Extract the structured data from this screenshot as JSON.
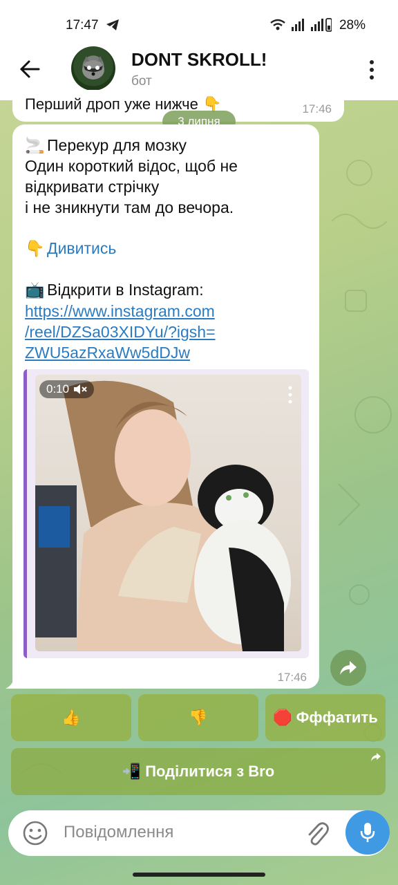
{
  "status": {
    "time": "17:47",
    "battery": "28%"
  },
  "header": {
    "title": "DONT SKROLL!",
    "subtitle": "бот"
  },
  "previous_message": {
    "text": "Перший дроп уже нижче 👇",
    "time": "17:46"
  },
  "date_separator": "3 липня",
  "message": {
    "line1": "Перекур для мозку",
    "line2": "Один короткий відос, щоб не",
    "line3": "відкривати стрічку",
    "line4": "і не зникнути там до вечора.",
    "watch_link": "Дивитись",
    "instagram_label": "Відкрити в Instagram:",
    "url_line1": "https://www.instagram.com",
    "url_line2": "/reel/DZSa03XIDYu/?igsh=",
    "url_line3": "ZWU5azRxaWw5dDJw",
    "time": "17:46",
    "video": {
      "duration": "0:10",
      "muted": true
    }
  },
  "keyboard": {
    "row1": [
      "👍",
      "👎",
      "Фффатить"
    ],
    "row2": "Поділитися з Bro"
  },
  "composer": {
    "placeholder": "Повідомлення"
  },
  "colors": {
    "accent": "#3f99e3",
    "link": "#2b7bc0",
    "media_bar": "#8b5fc7"
  }
}
